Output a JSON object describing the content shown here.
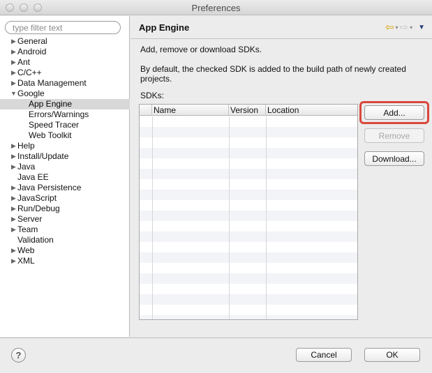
{
  "window": {
    "title": "Preferences"
  },
  "sidebar": {
    "filter_placeholder": "type filter text",
    "tree": [
      {
        "label": "General",
        "expander": "▶",
        "level": 0
      },
      {
        "label": "Android",
        "expander": "▶",
        "level": 0
      },
      {
        "label": "Ant",
        "expander": "▶",
        "level": 0
      },
      {
        "label": "C/C++",
        "expander": "▶",
        "level": 0
      },
      {
        "label": "Data Management",
        "expander": "▶",
        "level": 0
      },
      {
        "label": "Google",
        "expander": "▼",
        "level": 0
      },
      {
        "label": "App Engine",
        "expander": "",
        "level": 1,
        "selected": true
      },
      {
        "label": "Errors/Warnings",
        "expander": "",
        "level": 1
      },
      {
        "label": "Speed Tracer",
        "expander": "",
        "level": 1
      },
      {
        "label": "Web Toolkit",
        "expander": "",
        "level": 1
      },
      {
        "label": "Help",
        "expander": "▶",
        "level": 0
      },
      {
        "label": "Install/Update",
        "expander": "▶",
        "level": 0
      },
      {
        "label": "Java",
        "expander": "▶",
        "level": 0
      },
      {
        "label": "Java EE",
        "expander": "",
        "level": 0
      },
      {
        "label": "Java Persistence",
        "expander": "▶",
        "level": 0
      },
      {
        "label": "JavaScript",
        "expander": "▶",
        "level": 0
      },
      {
        "label": "Run/Debug",
        "expander": "▶",
        "level": 0
      },
      {
        "label": "Server",
        "expander": "▶",
        "level": 0
      },
      {
        "label": "Team",
        "expander": "▶",
        "level": 0
      },
      {
        "label": "Validation",
        "expander": "",
        "level": 0
      },
      {
        "label": "Web",
        "expander": "▶",
        "level": 0
      },
      {
        "label": "XML",
        "expander": "▶",
        "level": 0
      }
    ]
  },
  "main": {
    "title": "App Engine",
    "nav": {
      "back_icon": "⇦",
      "forward_icon": "⇨",
      "dropdown_icon": "▾",
      "menu_icon": "▼"
    },
    "description": "Add, remove or download SDKs.",
    "note": "By default, the checked SDK is added to the build path of newly created projects.",
    "sdks_label": "SDKs:",
    "table": {
      "columns": [
        "Name",
        "Version",
        "Location"
      ],
      "rows": []
    },
    "buttons": {
      "add": "Add...",
      "remove": "Remove",
      "download": "Download..."
    }
  },
  "footer": {
    "help": "?",
    "cancel": "Cancel",
    "ok": "OK"
  },
  "colors": {
    "highlight": "#d9483b",
    "selection": "#d8d8d8"
  }
}
